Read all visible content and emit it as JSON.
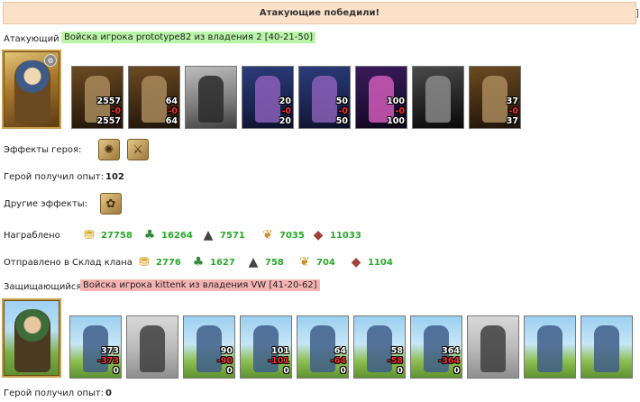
{
  "banner": {
    "title": "Атакующие победили!",
    "bracket": "]"
  },
  "attacker": {
    "role_label": "Атакующий",
    "army_label": "Войска игрока prototype82 из владения 2 [40-21-50]",
    "hero_icon": "hero-portrait-attacker",
    "units": [
      {
        "n1": "2557",
        "n2": "-0",
        "n3": "2557",
        "style": "dark"
      },
      {
        "n1": "64",
        "n2": "-0",
        "n3": "64",
        "style": "dark"
      },
      {
        "n1": "",
        "n2": "",
        "n3": "",
        "style": "grey"
      },
      {
        "n1": "20",
        "n2": "-0",
        "n3": "20",
        "style": "blue"
      },
      {
        "n1": "50",
        "n2": "-0",
        "n3": "50",
        "style": "blue"
      },
      {
        "n1": "100",
        "n2": "-0",
        "n3": "100",
        "style": "purple"
      },
      {
        "n1": "",
        "n2": "",
        "n3": "",
        "style": "night"
      },
      {
        "n1": "37",
        "n2": "-0",
        "n3": "37",
        "style": "dark"
      }
    ],
    "hero_effects_label": "Эффекты героя:",
    "hero_effects": [
      {
        "icon": "crab-effect-icon",
        "glyph": "✺"
      },
      {
        "icon": "sword-effect-icon",
        "glyph": "⚔"
      }
    ],
    "exp_label": "Герой получил опыт:",
    "exp_value": "102",
    "other_effects_label": "Другие эффекты:",
    "other_effects": [
      {
        "icon": "bag-effect-icon",
        "glyph": "✿"
      }
    ],
    "loot_label": "Награблено",
    "loot": [
      {
        "icon": "gold-icon",
        "glyph": "⛃",
        "color": "#d4a017",
        "value": "27758"
      },
      {
        "icon": "wood-icon",
        "glyph": "♣",
        "color": "#2e8b3a",
        "value": "16264"
      },
      {
        "icon": "ore-icon",
        "glyph": "▲",
        "color": "#444444",
        "value": "7571"
      },
      {
        "icon": "wheat-icon",
        "glyph": "❦",
        "color": "#c8902a",
        "value": "7035"
      },
      {
        "icon": "clay-icon",
        "glyph": "◆",
        "color": "#a0443a",
        "value": "11033"
      }
    ],
    "clan_label": "Отправлено в Склад клана",
    "clan": [
      {
        "icon": "gold-icon",
        "glyph": "⛃",
        "color": "#d4a017",
        "value": "2776"
      },
      {
        "icon": "wood-icon",
        "glyph": "♣",
        "color": "#2e8b3a",
        "value": "1627"
      },
      {
        "icon": "ore-icon",
        "glyph": "▲",
        "color": "#444444",
        "value": "758"
      },
      {
        "icon": "wheat-icon",
        "glyph": "❦",
        "color": "#c8902a",
        "value": "704"
      },
      {
        "icon": "clay-icon",
        "glyph": "◆",
        "color": "#a0443a",
        "value": "1104"
      }
    ]
  },
  "defender": {
    "role_label": "Защищающийся",
    "army_label": "Войска игрока kittenk из владения VW [41-20-62]",
    "hero_icon": "hero-portrait-defender",
    "units": [
      {
        "n1": "373",
        "n2": "-373",
        "n3": "0",
        "style": "sky"
      },
      {
        "n1": "",
        "n2": "",
        "n3": "",
        "style": "skygrey"
      },
      {
        "n1": "90",
        "n2": "-90",
        "n3": "0",
        "style": "sky"
      },
      {
        "n1": "101",
        "n2": "-101",
        "n3": "0",
        "style": "sky"
      },
      {
        "n1": "64",
        "n2": "-64",
        "n3": "0",
        "style": "sky"
      },
      {
        "n1": "58",
        "n2": "-58",
        "n3": "0",
        "style": "sky"
      },
      {
        "n1": "364",
        "n2": "-364",
        "n3": "0",
        "style": "sky"
      },
      {
        "n1": "",
        "n2": "",
        "n3": "",
        "style": "skygrey"
      },
      {
        "n1": "",
        "n2": "",
        "n3": "",
        "style": "sky"
      },
      {
        "n1": "",
        "n2": "",
        "n3": "",
        "style": "sky"
      }
    ],
    "exp_label": "Герой получил опыт:",
    "exp_value": "0"
  }
}
